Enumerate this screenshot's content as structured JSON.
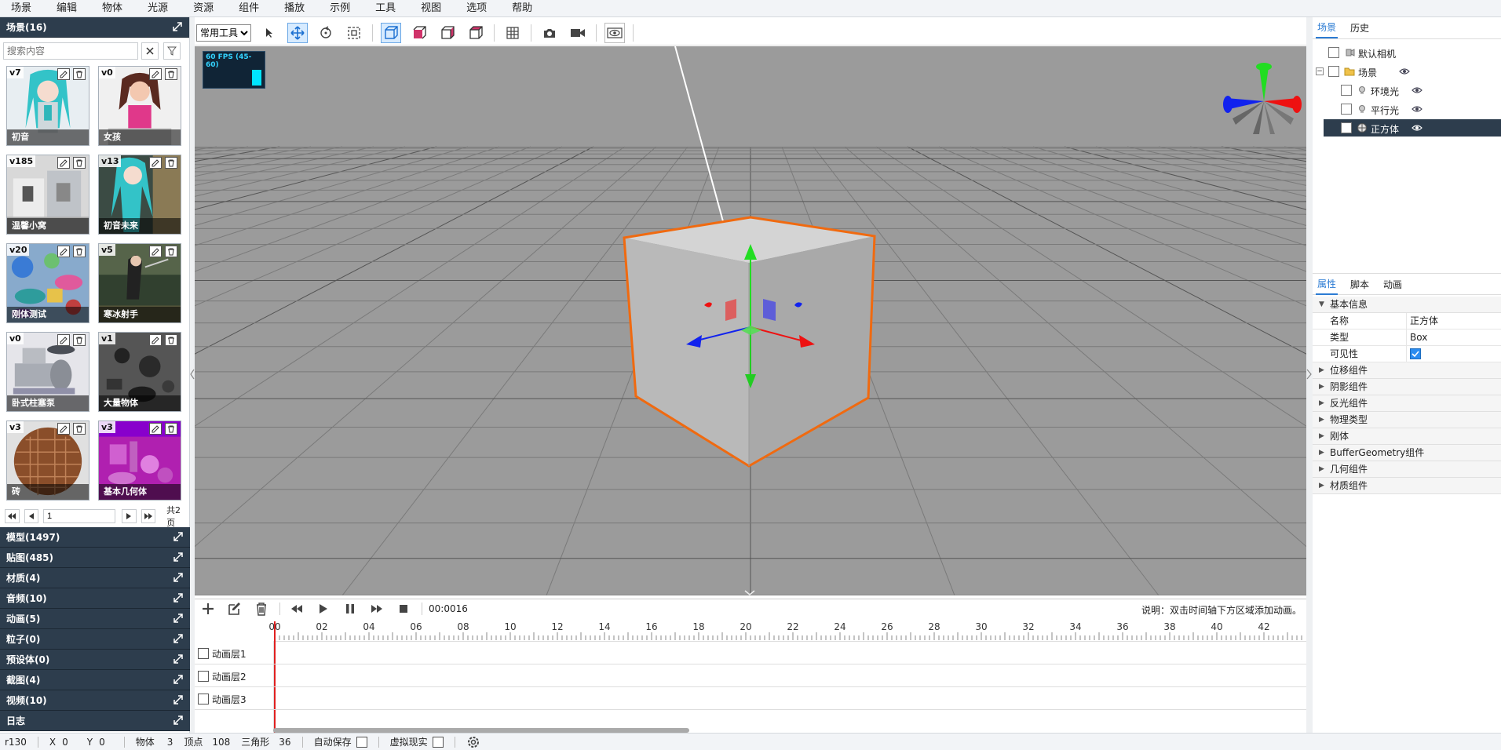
{
  "menu": [
    "场景",
    "编辑",
    "物体",
    "光源",
    "资源",
    "组件",
    "播放",
    "示例",
    "工具",
    "视图",
    "选项",
    "帮助"
  ],
  "left": {
    "scene_header": "场景(16)",
    "search_placeholder": "搜索内容",
    "scenes": [
      {
        "ver": "v7",
        "name": "初音",
        "thumb": "teal-figure"
      },
      {
        "ver": "v0",
        "name": "女孩",
        "thumb": "girl-figure"
      },
      {
        "ver": "v185",
        "name": "温馨小窝",
        "thumb": "room"
      },
      {
        "ver": "v13",
        "name": "初音未来",
        "thumb": "teal-figure-2"
      },
      {
        "ver": "v20",
        "name": "刚体测试",
        "thumb": "rigid-bodies"
      },
      {
        "ver": "v5",
        "name": "寒冰射手",
        "thumb": "archer"
      },
      {
        "ver": "v0",
        "name": "卧式柱塞泵",
        "thumb": "pump"
      },
      {
        "ver": "v1",
        "name": "大量物体",
        "thumb": "many-objects"
      },
      {
        "ver": "v3",
        "name": "砖",
        "thumb": "brick-sphere"
      },
      {
        "ver": "v3",
        "name": "基本几何体",
        "thumb": "basic-geometry"
      }
    ],
    "pager": {
      "page": "1",
      "total": "共2页"
    },
    "sections": [
      "模型(1497)",
      "贴图(485)",
      "材质(4)",
      "音频(10)",
      "动画(5)",
      "粒子(0)",
      "预设体(0)",
      "截图(4)",
      "视频(10)",
      "日志"
    ]
  },
  "toolbar": {
    "tool_select": "常用工具",
    "tools": [
      "select-arrow-icon",
      "move-icon",
      "rotate-icon",
      "scale-icon",
      "box-front-icon",
      "box-top-icon",
      "box-side-icon",
      "box-corner-icon",
      "grid-icon",
      "camera-icon",
      "video-icon",
      "eye-icon"
    ]
  },
  "viewport": {
    "fps": "60 FPS (45-60)"
  },
  "timeline": {
    "time": "00:0016",
    "hint": "说明：双击时间轴下方区域添加动画。",
    "ticks": [
      "00",
      "02",
      "04",
      "06",
      "08",
      "10",
      "12",
      "14",
      "16",
      "18",
      "20",
      "22",
      "24",
      "26",
      "28",
      "30",
      "32",
      "34",
      "36",
      "38",
      "40",
      "42"
    ],
    "layers": [
      "动画层1",
      "动画层2",
      "动画层3"
    ]
  },
  "right": {
    "top_tabs": [
      "场景",
      "历史"
    ],
    "tree": [
      {
        "label": "默认相机",
        "indent": 0,
        "eye": false,
        "selected": false,
        "toggle": false,
        "icon": "camera"
      },
      {
        "label": "场景",
        "indent": 0,
        "eye": true,
        "selected": false,
        "toggle": true,
        "icon": "folder"
      },
      {
        "label": "环境光",
        "indent": 1,
        "eye": true,
        "selected": false,
        "toggle": false,
        "icon": "light"
      },
      {
        "label": "平行光",
        "indent": 1,
        "eye": true,
        "selected": false,
        "toggle": false,
        "icon": "light"
      },
      {
        "label": "正方体",
        "indent": 1,
        "eye": true,
        "selected": true,
        "toggle": false,
        "icon": "mesh"
      }
    ],
    "bottom_tabs": [
      "属性",
      "脚本",
      "动画"
    ],
    "basic_info": "基本信息",
    "props": [
      {
        "key": "名称",
        "value": "正方体"
      },
      {
        "key": "类型",
        "value": "Box"
      },
      {
        "key": "可见性",
        "value": ""
      }
    ],
    "groups": [
      "位移组件",
      "阴影组件",
      "反光组件",
      "物理类型",
      "刚体",
      "BufferGeometry组件",
      "几何组件",
      "材质组件"
    ]
  },
  "status": {
    "revision": "r130",
    "x_label": "X",
    "x_value": "0",
    "y_label": "Y",
    "y_value": "0",
    "objects_label": "物体",
    "objects_value": "3",
    "vertices_label": "顶点",
    "vertices_value": "108",
    "triangles_label": "三角形",
    "triangles_value": "36",
    "autosave_label": "自动保存",
    "vr_label": "虚拟现实"
  }
}
